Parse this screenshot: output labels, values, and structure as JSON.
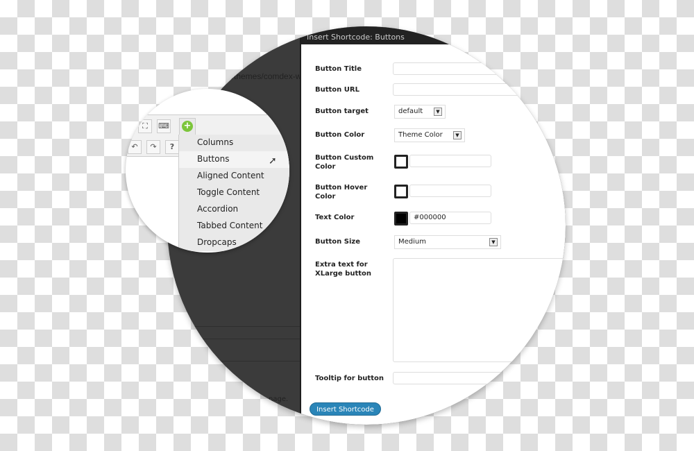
{
  "background_editor": {
    "url_fragment": "om/themes/comdex-w",
    "footer_fragment": "nage."
  },
  "dialog": {
    "title": "Insert Shortcode: Buttons",
    "fields": {
      "button_title": {
        "label": "Button Title",
        "value": ""
      },
      "button_url": {
        "label": "Button URL",
        "value": ""
      },
      "button_target": {
        "label": "Button target",
        "value": "default"
      },
      "button_color": {
        "label": "Button Color",
        "value": "Theme Color"
      },
      "custom_color": {
        "label": "Button Custom Color",
        "value": ""
      },
      "hover_color": {
        "label": "Button Hover Color",
        "value": ""
      },
      "text_color": {
        "label": "Text Color",
        "value": "#000000"
      },
      "button_size": {
        "label": "Button Size",
        "value": "Medium"
      },
      "extra_text": {
        "label": "Extra text for XLarge button",
        "value": ""
      },
      "tooltip": {
        "label": "Tooltip for button",
        "value": ""
      }
    },
    "submit_label": "Insert Shortcode",
    "accent": "#2a85b8"
  },
  "shortcode_menu": {
    "items": [
      "Columns",
      "Buttons",
      "Aligned Content",
      "Toggle Content",
      "Accordion",
      "Tabbed Content",
      "Dropcaps"
    ],
    "hovered": "Buttons"
  }
}
